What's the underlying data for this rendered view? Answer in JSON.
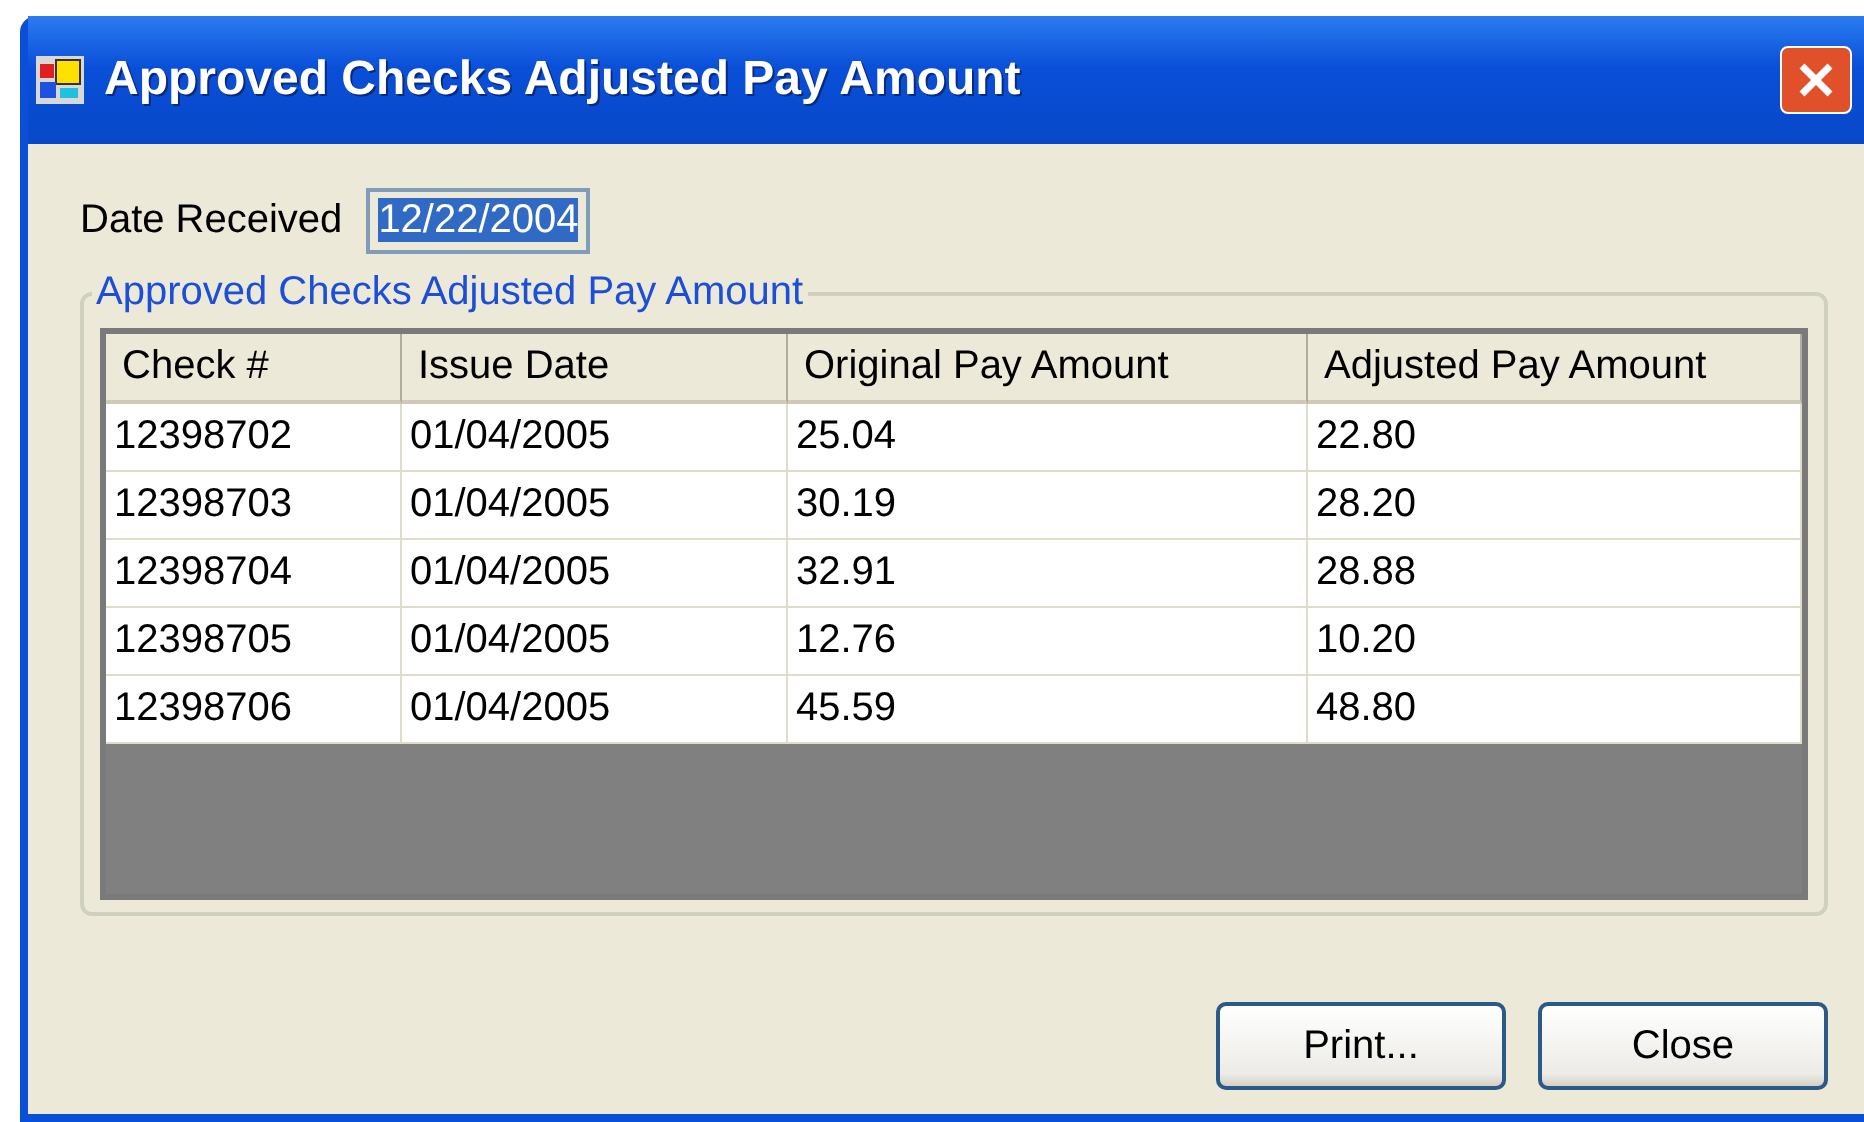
{
  "window": {
    "title": "Approved Checks Adjusted Pay Amount"
  },
  "date_received": {
    "label": "Date Received",
    "value": "12/22/2004"
  },
  "group": {
    "title": "Approved Checks Adjusted Pay Amount"
  },
  "table": {
    "columns": [
      "Check #",
      "Issue Date",
      "Original Pay Amount",
      "Adjusted Pay Amount"
    ],
    "rows": [
      [
        "12398702",
        "01/04/2005",
        "25.04",
        "22.80"
      ],
      [
        "12398703",
        "01/04/2005",
        "30.19",
        "28.20"
      ],
      [
        "12398704",
        "01/04/2005",
        "32.91",
        "28.88"
      ],
      [
        "12398705",
        "01/04/2005",
        "12.76",
        "10.20"
      ],
      [
        "12398706",
        "01/04/2005",
        "45.59",
        "48.80"
      ]
    ]
  },
  "buttons": [
    "Print...",
    "Close"
  ]
}
